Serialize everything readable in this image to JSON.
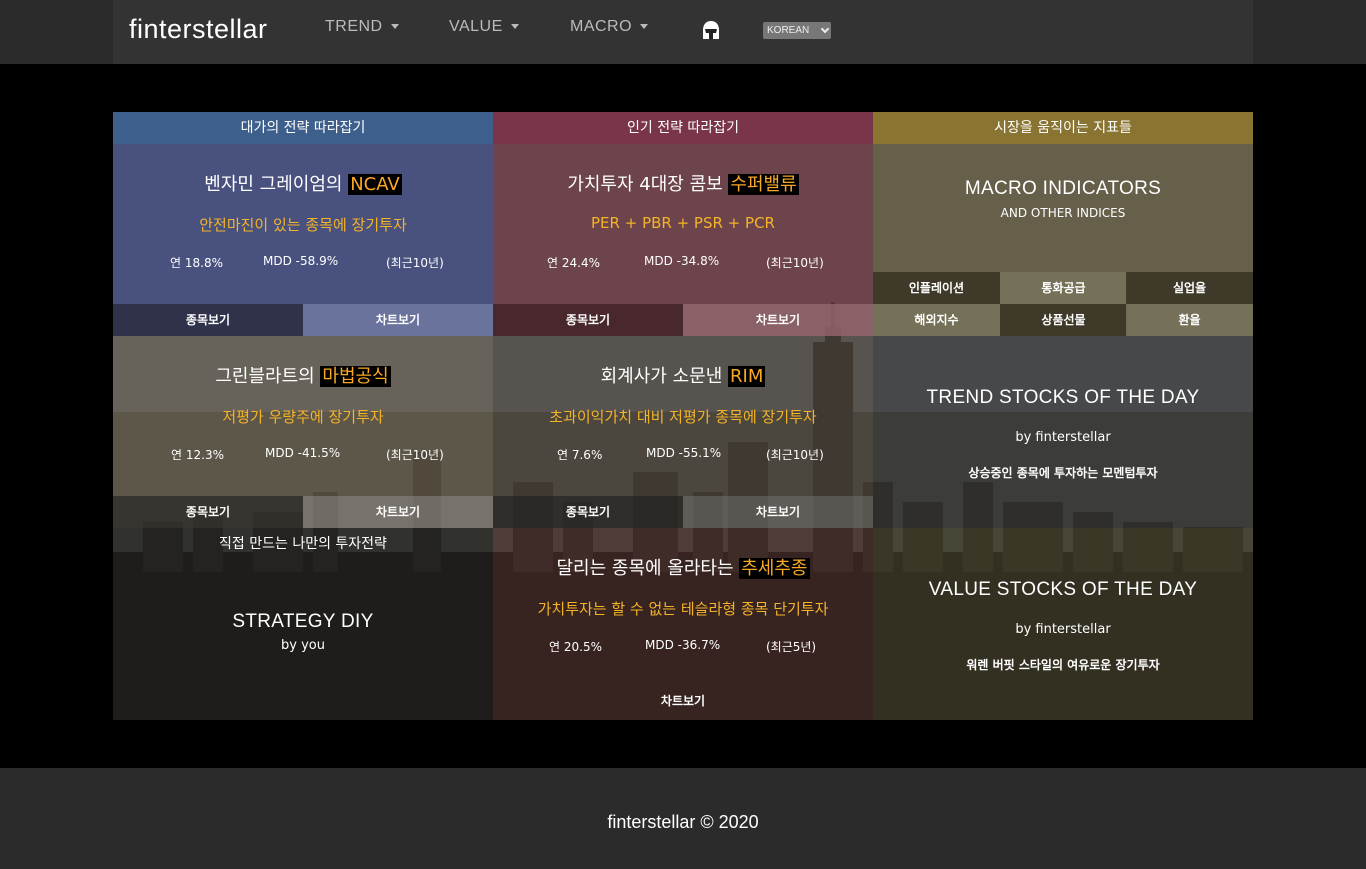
{
  "navbar": {
    "brand": "finterstellar",
    "items": [
      "TREND",
      "VALUE",
      "MACRO"
    ],
    "language": "KOREAN"
  },
  "colors": {
    "blue_header": "#3d5f8c",
    "red_header": "#7a3648",
    "gold_header": "#8a7432",
    "highlight": "#f9a825"
  },
  "grid": {
    "masters": {
      "header": "대가의 전략 따라잡기",
      "title_prefix": "벤자민 그레이엄의 ",
      "title_hl": "NCAV",
      "subtitle": "안전마진이 있는 종목에 장기투자",
      "cagr": "연 18.8%",
      "mdd": "MDD -58.9%",
      "period": "(최근10년)",
      "btn_stocks": "종목보기",
      "btn_chart": "차트보기"
    },
    "popular": {
      "header": "인기 전략 따라잡기",
      "title_prefix": "가치투자 4대장 콤보 ",
      "title_hl": "수퍼밸류",
      "subtitle": "PER + PBR + PSR + PCR",
      "cagr": "연 24.4%",
      "mdd": "MDD -34.8%",
      "period": "(최근10년)",
      "btn_stocks": "종목보기",
      "btn_chart": "차트보기"
    },
    "macro": {
      "header": "시장을 움직이는 지표들",
      "title": "MACRO INDICATORS",
      "subtitle": "AND OTHER INDICES",
      "buttons": [
        "인플레이션",
        "통화공급",
        "실업율",
        "해외지수",
        "상품선물",
        "환율"
      ]
    },
    "greenblatt": {
      "title_prefix": "그린블라트의 ",
      "title_hl": "마법공식",
      "subtitle": "저평가 우량주에 장기투자",
      "cagr": "연 12.3%",
      "mdd": "MDD -41.5%",
      "period": "(최근10년)",
      "btn_stocks": "종목보기",
      "btn_chart": "차트보기"
    },
    "rim": {
      "title_prefix": "회계사가 소문낸 ",
      "title_hl": "RIM",
      "subtitle": "초과이익가치 대비 저평가 종목에 장기투자",
      "cagr": "연 7.6%",
      "mdd": "MDD -55.1%",
      "period": "(최근10년)",
      "btn_stocks": "종목보기",
      "btn_chart": "차트보기"
    },
    "trend_stocks": {
      "title": "TREND STOCKS OF THE DAY",
      "by": "by finterstellar",
      "desc": "상승중인 종목에 투자하는 모멘텀투자"
    },
    "diy": {
      "header": "직접 만드는 나만의 투자전략",
      "title": "STRATEGY DIY",
      "by": "by you"
    },
    "trend_follow": {
      "title_prefix": "달리는 종목에 올라타는 ",
      "title_hl": "추세추종",
      "subtitle": "가치투자는 할 수 없는 테슬라형 종목 단기투자",
      "cagr": "연 20.5%",
      "mdd": "MDD -36.7%",
      "period": "(최근5년)",
      "btn_chart": "차트보기"
    },
    "value_stocks": {
      "title": "VALUE STOCKS OF THE DAY",
      "by": "by finterstellar",
      "desc": "워렌 버핏 스타일의 여유로운 장기투자"
    }
  },
  "footer": {
    "text": "finterstellar © 2020"
  }
}
